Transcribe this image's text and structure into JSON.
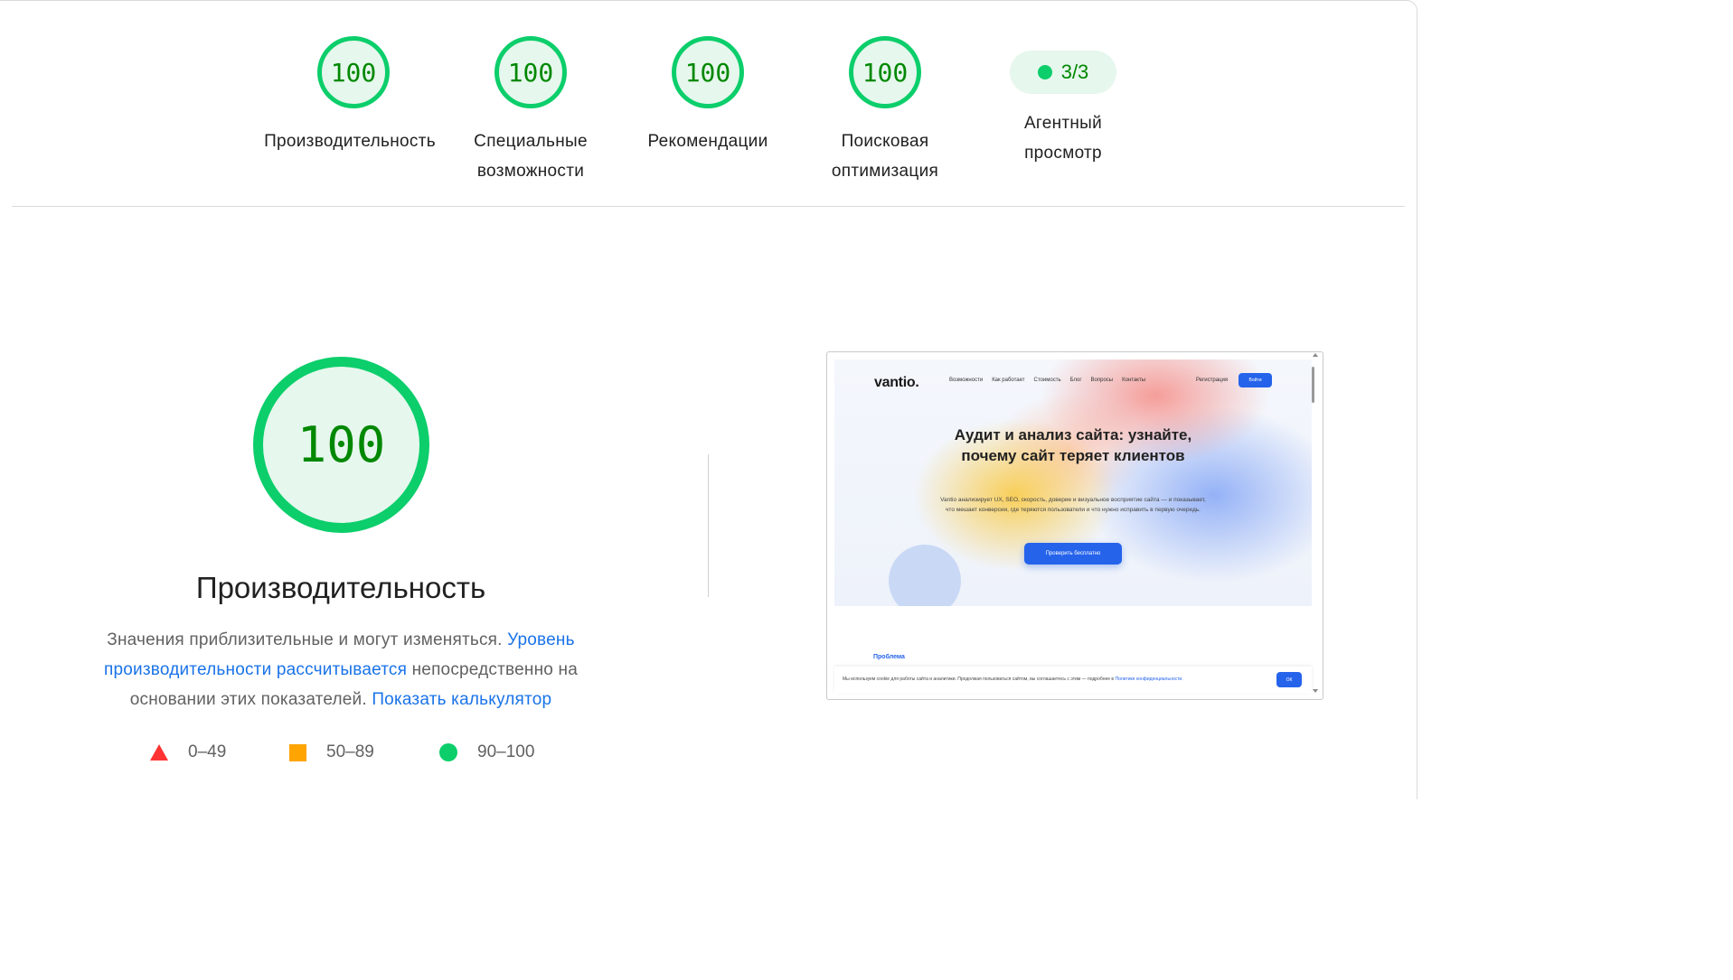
{
  "colors": {
    "pass": "#0cce6b",
    "pass_text": "#008800",
    "average": "#ffa400",
    "fail": "#ff3333",
    "link": "#1a73e8"
  },
  "categories": [
    {
      "score": "100",
      "label": "Производительность"
    },
    {
      "score": "100",
      "label": "Специальные возможности"
    },
    {
      "score": "100",
      "label": "Рекомендации"
    },
    {
      "score": "100",
      "label": "Поисковая оптимизация"
    }
  ],
  "agentic": {
    "fraction": "3/3",
    "label": "Агентный просмотр"
  },
  "performance": {
    "score": "100",
    "title": "Производительность",
    "desc_part1": "Значения приблизительные и могут изменяться. ",
    "desc_link1": "Уровень производительности рассчитывается",
    "desc_part2": " непосредственно на основании этих показателей. ",
    "desc_link2": "Показать калькулятор"
  },
  "legend": [
    {
      "icon": "triangle-fail-icon",
      "range": "0–49"
    },
    {
      "icon": "square-average-icon",
      "range": "50–89"
    },
    {
      "icon": "circle-pass-icon",
      "range": "90–100"
    }
  ],
  "thumbnail": {
    "logo": "vantio.",
    "nav": [
      "Возможности",
      "Как работает",
      "Стоимость",
      "Блог",
      "Вопросы",
      "Контакты"
    ],
    "register": "Регистрация",
    "login": "Войти",
    "headline": "Аудит и анализ сайта: узнайте, почему сайт теряет клиентов",
    "lead": "Vantio анализирует UX, SEO, скорость, доверие и визуальное восприятие сайта — и показывает, что мешает конверсии, где теряются пользователи и что нужно исправить в первую очередь.",
    "cta": "Проверить бесплатно",
    "section": "Проблема",
    "cookie_text": "Мы используем cookie для работы сайта и аналитики. Продолжая пользоваться сайтом, вы соглашаетесь с этим — подробнее в ",
    "cookie_link": "Политике конфиденциальности.",
    "cookie_ok": "ОК"
  }
}
